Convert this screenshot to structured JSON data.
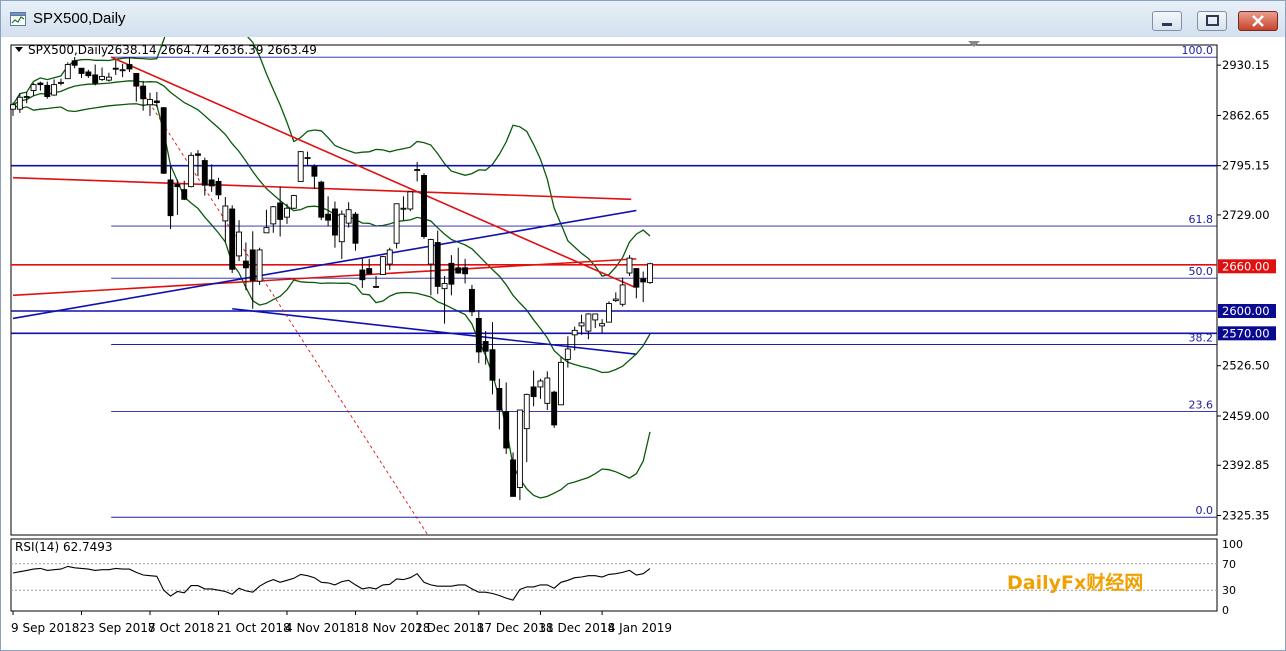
{
  "window": {
    "title": "SPX500,Daily"
  },
  "chart_header": {
    "symbol": "SPX500,Daily",
    "ohlc": "2638.14 2664.74 2636.39 2663.49"
  },
  "rsi_header": "RSI(14) 62.7493",
  "watermark": "DailyFx财经网",
  "colors": {
    "bull_body": "#ffffff",
    "bear_body": "#000000",
    "bollinger": "#0a5a0a",
    "trend_red": "#e01010",
    "trend_blue": "#1010b0",
    "fib": "#2020a0",
    "price_tag_red": "#e01010",
    "price_tag_blue": "#0a0a90",
    "watermark": "#f0a000"
  },
  "chart_data": [
    {
      "type": "candlestick",
      "title": "SPX500,Daily",
      "ylim": [
        2300,
        2960
      ],
      "y_ticks": [
        "2930.15",
        "2862.65",
        "2795.15",
        "2729.00",
        "2660.00",
        "2600.00",
        "2570.00",
        "2526.50",
        "2459.00",
        "2392.85",
        "2325.35"
      ],
      "x_ticks": [
        "9 Sep 2018",
        "23 Sep 2018",
        "7 Oct 2018",
        "21 Oct 2018",
        "4 Nov 2018",
        "18 Nov 2018",
        "2 Dec 2018",
        "17 Dec 2018",
        "31 Dec 2018",
        "14 Jan 2019"
      ],
      "price_tags": [
        {
          "label": "2660.00",
          "value": 2660,
          "color": "red"
        },
        {
          "label": "2600.00",
          "value": 2600,
          "color": "blue"
        },
        {
          "label": "2570.00",
          "value": 2570,
          "color": "blue"
        }
      ],
      "fibonacci": [
        {
          "label": "100.0",
          "value": 2940.9
        },
        {
          "label": "61.8",
          "value": 2714.0
        },
        {
          "label": "50.0",
          "value": 2644.0
        },
        {
          "label": "38.2",
          "value": 2555.0
        },
        {
          "label": "23.6",
          "value": 2465.0
        },
        {
          "label": "0.0",
          "value": 2323.0
        }
      ],
      "horizontal_lines": [
        {
          "value": 2795.15,
          "color": "blue"
        },
        {
          "value": 2600.0,
          "color": "blue"
        },
        {
          "value": 2570.0,
          "color": "blue"
        },
        {
          "value": 2662.0,
          "color": "red"
        }
      ],
      "trend_lines": [
        {
          "color": "red",
          "points": [
            [
              "2018-09-29",
              2940.9
            ],
            [
              "2019-01-21",
              2632.0
            ]
          ]
        },
        {
          "color": "red",
          "points": [
            [
              "2018-09-10",
              2779.0
            ],
            [
              "2019-01-19",
              2750.0
            ]
          ]
        },
        {
          "color": "red",
          "points": [
            [
              "2018-09-10",
              2621.0
            ],
            [
              "2019-01-22",
              2670.0
            ]
          ]
        },
        {
          "color": "blue",
          "points": [
            [
              "2018-09-10",
              2590.0
            ],
            [
              "2019-01-22",
              2735.0
            ]
          ]
        },
        {
          "color": "blue",
          "points": [
            [
              "2018-10-24",
              2603.0
            ],
            [
              "2019-01-22",
              2542.0
            ]
          ]
        },
        {
          "color": "red-dashed",
          "points": [
            [
              "2018-10-04",
              2907.0
            ],
            [
              "2018-12-05",
              2300.0
            ]
          ]
        }
      ],
      "candles": [
        {
          "d": "2018-09-10",
          "o": 2871.0,
          "h": 2880.0,
          "l": 2862.0,
          "c": 2877.0
        },
        {
          "d": "2018-09-11",
          "o": 2871.0,
          "h": 2892.0,
          "l": 2866.0,
          "c": 2887.0
        },
        {
          "d": "2018-09-12",
          "o": 2888.0,
          "h": 2894.0,
          "l": 2879.0,
          "c": 2888.0
        },
        {
          "d": "2018-09-13",
          "o": 2896.0,
          "h": 2906.0,
          "l": 2889.0,
          "c": 2904.0
        },
        {
          "d": "2018-09-14",
          "o": 2906.0,
          "h": 2908.0,
          "l": 2896.0,
          "c": 2904.0
        },
        {
          "d": "2018-09-17",
          "o": 2903.0,
          "h": 2908.0,
          "l": 2885.0,
          "c": 2888.0
        },
        {
          "d": "2018-09-18",
          "o": 2890.0,
          "h": 2911.0,
          "l": 2889.0,
          "c": 2904.0
        },
        {
          "d": "2018-09-19",
          "o": 2906.0,
          "h": 2912.0,
          "l": 2903.0,
          "c": 2907.0
        },
        {
          "d": "2018-09-20",
          "o": 2912.0,
          "h": 2934.0,
          "l": 2912.0,
          "c": 2931.0
        },
        {
          "d": "2018-09-21",
          "o": 2936.0,
          "h": 2941.0,
          "l": 2926.0,
          "c": 2930.0
        },
        {
          "d": "2018-09-24",
          "o": 2926.0,
          "h": 2926.0,
          "l": 2913.0,
          "c": 2919.0
        },
        {
          "d": "2018-09-25",
          "o": 2921.0,
          "h": 2924.0,
          "l": 2913.0,
          "c": 2916.0
        },
        {
          "d": "2018-09-26",
          "o": 2917.0,
          "h": 2931.0,
          "l": 2903.0,
          "c": 2906.0
        },
        {
          "d": "2018-09-27",
          "o": 2911.0,
          "h": 2927.0,
          "l": 2909.0,
          "c": 2915.0
        },
        {
          "d": "2018-09-28",
          "o": 2910.0,
          "h": 2920.0,
          "l": 2908.0,
          "c": 2914.0
        },
        {
          "d": "2018-10-01",
          "o": 2926.0,
          "h": 2937.0,
          "l": 2917.0,
          "c": 2925.0
        },
        {
          "d": "2018-10-02",
          "o": 2923.0,
          "h": 2932.0,
          "l": 2914.0,
          "c": 2924.0
        },
        {
          "d": "2018-10-03",
          "o": 2931.0,
          "h": 2940.0,
          "l": 2921.0,
          "c": 2925.0
        },
        {
          "d": "2018-10-04",
          "o": 2919.0,
          "h": 2919.0,
          "l": 2881.0,
          "c": 2902.0
        },
        {
          "d": "2018-10-05",
          "o": 2902.0,
          "h": 2909.0,
          "l": 2869.0,
          "c": 2885.0
        },
        {
          "d": "2018-10-08",
          "o": 2877.0,
          "h": 2893.0,
          "l": 2862.0,
          "c": 2884.0
        },
        {
          "d": "2018-10-09",
          "o": 2882.0,
          "h": 2894.0,
          "l": 2874.0,
          "c": 2880.0
        },
        {
          "d": "2018-10-10",
          "o": 2873.0,
          "h": 2874.0,
          "l": 2784.0,
          "c": 2785.0
        },
        {
          "d": "2018-10-11",
          "o": 2776.0,
          "h": 2795.0,
          "l": 2710.0,
          "c": 2728.0
        },
        {
          "d": "2018-10-12",
          "o": 2770.0,
          "h": 2776.0,
          "l": 2729.0,
          "c": 2767.0
        },
        {
          "d": "2018-10-15",
          "o": 2763.0,
          "h": 2775.0,
          "l": 2749.0,
          "c": 2750.0
        },
        {
          "d": "2018-10-16",
          "o": 2767.0,
          "h": 2813.0,
          "l": 2766.0,
          "c": 2809.0
        },
        {
          "d": "2018-10-17",
          "o": 2811.0,
          "h": 2816.0,
          "l": 2781.0,
          "c": 2809.0
        },
        {
          "d": "2018-10-18",
          "o": 2802.0,
          "h": 2806.0,
          "l": 2755.0,
          "c": 2769.0
        },
        {
          "d": "2018-10-19",
          "o": 2776.0,
          "h": 2797.0,
          "l": 2760.0,
          "c": 2768.0
        },
        {
          "d": "2018-10-22",
          "o": 2774.0,
          "h": 2779.0,
          "l": 2750.0,
          "c": 2756.0
        },
        {
          "d": "2018-10-23",
          "o": 2721.0,
          "h": 2753.0,
          "l": 2692.0,
          "c": 2741.0
        },
        {
          "d": "2018-10-24",
          "o": 2737.0,
          "h": 2742.0,
          "l": 2651.0,
          "c": 2656.0
        },
        {
          "d": "2018-10-25",
          "o": 2674.0,
          "h": 2722.0,
          "l": 2667.0,
          "c": 2706.0
        },
        {
          "d": "2018-10-26",
          "o": 2667.0,
          "h": 2692.0,
          "l": 2628.0,
          "c": 2658.0
        },
        {
          "d": "2018-10-29",
          "o": 2682.0,
          "h": 2707.0,
          "l": 2603.0,
          "c": 2641.0
        },
        {
          "d": "2018-10-30",
          "o": 2640.0,
          "h": 2685.0,
          "l": 2635.0,
          "c": 2682.0
        },
        {
          "d": "2018-10-31",
          "o": 2705.0,
          "h": 2736.0,
          "l": 2705.0,
          "c": 2712.0
        },
        {
          "d": "2018-11-01",
          "o": 2717.0,
          "h": 2741.0,
          "l": 2705.0,
          "c": 2740.0
        },
        {
          "d": "2018-11-02",
          "o": 2745.0,
          "h": 2767.0,
          "l": 2700.0,
          "c": 2723.0
        },
        {
          "d": "2018-11-05",
          "o": 2726.0,
          "h": 2744.0,
          "l": 2717.0,
          "c": 2738.0
        },
        {
          "d": "2018-11-06",
          "o": 2738.0,
          "h": 2756.0,
          "l": 2737.0,
          "c": 2755.0
        },
        {
          "d": "2018-11-07",
          "o": 2774.0,
          "h": 2815.0,
          "l": 2774.0,
          "c": 2814.0
        },
        {
          "d": "2018-11-08",
          "o": 2806.0,
          "h": 2814.0,
          "l": 2794.0,
          "c": 2806.0
        },
        {
          "d": "2018-11-09",
          "o": 2794.0,
          "h": 2797.0,
          "l": 2764.0,
          "c": 2781.0
        },
        {
          "d": "2018-11-12",
          "o": 2773.0,
          "h": 2775.0,
          "l": 2722.0,
          "c": 2726.0
        },
        {
          "d": "2018-11-13",
          "o": 2730.0,
          "h": 2754.0,
          "l": 2714.0,
          "c": 2722.0
        },
        {
          "d": "2018-11-14",
          "o": 2737.0,
          "h": 2747.0,
          "l": 2685.0,
          "c": 2702.0
        },
        {
          "d": "2018-11-15",
          "o": 2693.0,
          "h": 2735.0,
          "l": 2670.0,
          "c": 2730.0
        },
        {
          "d": "2018-11-16",
          "o": 2718.0,
          "h": 2746.0,
          "l": 2712.0,
          "c": 2736.0
        },
        {
          "d": "2018-11-19",
          "o": 2730.0,
          "h": 2733.0,
          "l": 2681.0,
          "c": 2691.0
        },
        {
          "d": "2018-11-20",
          "o": 2655.0,
          "h": 2670.0,
          "l": 2631.0,
          "c": 2642.0
        },
        {
          "d": "2018-11-21",
          "o": 2657.0,
          "h": 2670.0,
          "l": 2649.0,
          "c": 2650.0
        },
        {
          "d": "2018-11-23",
          "o": 2633.0,
          "h": 2647.0,
          "l": 2631.0,
          "c": 2633.0
        },
        {
          "d": "2018-11-26",
          "o": 2649.0,
          "h": 2674.0,
          "l": 2649.0,
          "c": 2673.0
        },
        {
          "d": "2018-11-27",
          "o": 2663.0,
          "h": 2685.0,
          "l": 2655.0,
          "c": 2682.0
        },
        {
          "d": "2018-11-28",
          "o": 2691.0,
          "h": 2744.0,
          "l": 2684.0,
          "c": 2744.0
        },
        {
          "d": "2018-11-29",
          "o": 2737.0,
          "h": 2754.0,
          "l": 2722.0,
          "c": 2738.0
        },
        {
          "d": "2018-11-30",
          "o": 2737.0,
          "h": 2760.0,
          "l": 2734.0,
          "c": 2760.0
        },
        {
          "d": "2018-12-03",
          "o": 2790.0,
          "h": 2800.0,
          "l": 2774.0,
          "c": 2790.0
        },
        {
          "d": "2018-12-04",
          "o": 2782.0,
          "h": 2785.0,
          "l": 2697.0,
          "c": 2700.0
        },
        {
          "d": "2018-12-06",
          "o": 2663.0,
          "h": 2697.0,
          "l": 2621.0,
          "c": 2696.0
        },
        {
          "d": "2018-12-07",
          "o": 2692.0,
          "h": 2708.0,
          "l": 2623.0,
          "c": 2633.0
        },
        {
          "d": "2018-12-10",
          "o": 2630.0,
          "h": 2647.0,
          "l": 2583.0,
          "c": 2637.0
        },
        {
          "d": "2018-12-11",
          "o": 2664.0,
          "h": 2675.0,
          "l": 2621.0,
          "c": 2636.0
        },
        {
          "d": "2018-12-12",
          "o": 2658.0,
          "h": 2685.0,
          "l": 2650.0,
          "c": 2651.0
        },
        {
          "d": "2018-12-13",
          "o": 2658.0,
          "h": 2670.0,
          "l": 2637.0,
          "c": 2650.0
        },
        {
          "d": "2018-12-14",
          "o": 2629.0,
          "h": 2635.0,
          "l": 2593.0,
          "c": 2599.0
        },
        {
          "d": "2018-12-17",
          "o": 2590.0,
          "h": 2601.0,
          "l": 2530.0,
          "c": 2545.0
        },
        {
          "d": "2018-12-18",
          "o": 2559.0,
          "h": 2573.0,
          "l": 2528.0,
          "c": 2546.0
        },
        {
          "d": "2018-12-19",
          "o": 2548.0,
          "h": 2585.0,
          "l": 2488.0,
          "c": 2507.0
        },
        {
          "d": "2018-12-20",
          "o": 2496.0,
          "h": 2509.0,
          "l": 2441.0,
          "c": 2467.0
        },
        {
          "d": "2018-12-21",
          "o": 2465.0,
          "h": 2504.0,
          "l": 2408.0,
          "c": 2416.0
        },
        {
          "d": "2018-12-24",
          "o": 2400.0,
          "h": 2410.0,
          "l": 2351.0,
          "c": 2351.0
        },
        {
          "d": "2018-12-26",
          "o": 2363.0,
          "h": 2467.0,
          "l": 2346.0,
          "c": 2467.0
        },
        {
          "d": "2018-12-27",
          "o": 2442.0,
          "h": 2489.0,
          "l": 2397.0,
          "c": 2488.0
        },
        {
          "d": "2018-12-28",
          "o": 2498.0,
          "h": 2520.0,
          "l": 2472.0,
          "c": 2485.0
        },
        {
          "d": "2018-12-31",
          "o": 2498.0,
          "h": 2509.0,
          "l": 2482.0,
          "c": 2506.0
        },
        {
          "d": "2019-01-02",
          "o": 2476.0,
          "h": 2519.0,
          "l": 2467.0,
          "c": 2510.0
        },
        {
          "d": "2019-01-03",
          "o": 2491.0,
          "h": 2493.0,
          "l": 2443.0,
          "c": 2447.0
        },
        {
          "d": "2019-01-04",
          "o": 2474.0,
          "h": 2538.0,
          "l": 2474.0,
          "c": 2531.0
        },
        {
          "d": "2019-01-07",
          "o": 2535.0,
          "h": 2566.0,
          "l": 2524.0,
          "c": 2549.0
        },
        {
          "d": "2019-01-08",
          "o": 2568.0,
          "h": 2579.0,
          "l": 2547.0,
          "c": 2574.0
        },
        {
          "d": "2019-01-09",
          "o": 2580.0,
          "h": 2595.0,
          "l": 2568.0,
          "c": 2584.0
        },
        {
          "d": "2019-01-10",
          "o": 2573.0,
          "h": 2597.0,
          "l": 2562.0,
          "c": 2596.0
        },
        {
          "d": "2019-01-11",
          "o": 2588.0,
          "h": 2596.0,
          "l": 2577.0,
          "c": 2596.0
        },
        {
          "d": "2019-01-14",
          "o": 2580.0,
          "h": 2589.0,
          "l": 2571.0,
          "c": 2583.0
        },
        {
          "d": "2019-01-15",
          "o": 2585.0,
          "h": 2613.0,
          "l": 2585.0,
          "c": 2610.0
        },
        {
          "d": "2019-01-16",
          "o": 2614.0,
          "h": 2625.0,
          "l": 2612.0,
          "c": 2616.0
        },
        {
          "d": "2019-01-17",
          "o": 2609.0,
          "h": 2645.0,
          "l": 2606.0,
          "c": 2635.0
        },
        {
          "d": "2019-01-18",
          "o": 2651.0,
          "h": 2675.0,
          "l": 2647.0,
          "c": 2671.0
        },
        {
          "d": "2019-01-22",
          "o": 2657.0,
          "h": 2657.0,
          "l": 2617.0,
          "c": 2632.0
        },
        {
          "d": "2019-01-23",
          "o": 2643.0,
          "h": 2653.0,
          "l": 2612.0,
          "c": 2639.0
        },
        {
          "d": "2019-01-24",
          "o": 2638.14,
          "h": 2664.74,
          "l": 2636.39,
          "c": 2663.49
        }
      ]
    },
    {
      "type": "line",
      "title": "RSI(14) 62.7493",
      "ylim": [
        0,
        100
      ],
      "y_ticks": [
        "100",
        "70",
        "30",
        "0"
      ],
      "levels": [
        70,
        30
      ],
      "series": [
        {
          "values": [
            56,
            58,
            60,
            62,
            63,
            60,
            61,
            62,
            66,
            64,
            63,
            62,
            60,
            61,
            61,
            63,
            62,
            62,
            57,
            53,
            52,
            51,
            30,
            21,
            28,
            26,
            37,
            37,
            32,
            32,
            30,
            28,
            24,
            33,
            29,
            27,
            36,
            42,
            46,
            42,
            45,
            48,
            54,
            52,
            49,
            42,
            41,
            38,
            43,
            45,
            38,
            32,
            34,
            32,
            38,
            39,
            47,
            46,
            49,
            55,
            42,
            38,
            36,
            36,
            36,
            38,
            38,
            32,
            27,
            27,
            25,
            22,
            18,
            15,
            31,
            35,
            35,
            38,
            38,
            33,
            42,
            45,
            49,
            50,
            52,
            52,
            50,
            54,
            55,
            57,
            60,
            53,
            55,
            62.7493
          ]
        }
      ]
    }
  ]
}
